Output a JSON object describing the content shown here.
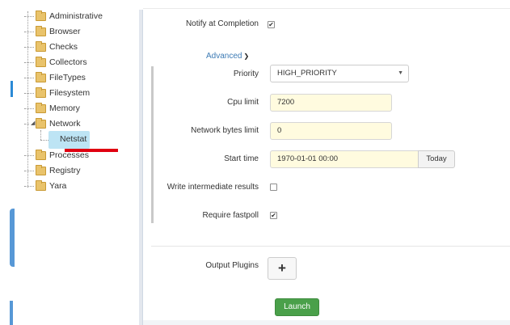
{
  "tree": {
    "items": [
      {
        "label": "Administrative"
      },
      {
        "label": "Browser"
      },
      {
        "label": "Checks"
      },
      {
        "label": "Collectors"
      },
      {
        "label": "FileTypes"
      },
      {
        "label": "Filesystem"
      },
      {
        "label": "Memory"
      },
      {
        "label": "Network",
        "expanded": true
      },
      {
        "label": "Netstat",
        "selected": true
      },
      {
        "label": "Processes"
      },
      {
        "label": "Registry"
      },
      {
        "label": "Yara"
      }
    ]
  },
  "form": {
    "notify_label": "Notify at Completion",
    "notify_checked": true,
    "advanced_label": "Advanced",
    "priority_label": "Priority",
    "priority_value": "HIGH_PRIORITY",
    "cpu_label": "Cpu limit",
    "cpu_value": "7200",
    "network_label": "Network bytes limit",
    "network_value": "0",
    "start_label": "Start time",
    "start_value": "1970-01-01 00:00",
    "today_label": "Today",
    "write_label": "Write intermediate results",
    "write_checked": false,
    "fastpoll_label": "Require fastpoll",
    "fastpoll_checked": true,
    "output_label": "Output Plugins",
    "add_glyph": "+",
    "launch_label": "Launch"
  },
  "colors": {
    "accent_link": "#3d7bb5",
    "launch_green": "#4aa04a",
    "selection_blue": "#bde4f4",
    "highlight_red": "#e00010",
    "input_yellow": "#fffbdf"
  },
  "icons": {
    "folder": "folder-icon",
    "chevron": "chevron-down-icon",
    "caret": "caret-down-icon",
    "check": "check-icon",
    "plus": "plus-icon"
  }
}
